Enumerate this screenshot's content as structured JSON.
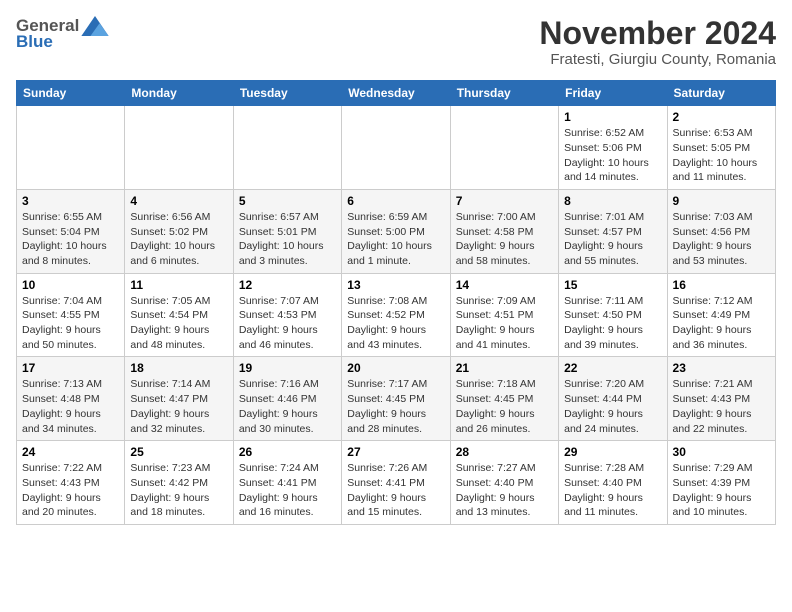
{
  "logo": {
    "general": "General",
    "blue": "Blue"
  },
  "title": "November 2024",
  "location": "Fratesti, Giurgiu County, Romania",
  "days_header": [
    "Sunday",
    "Monday",
    "Tuesday",
    "Wednesday",
    "Thursday",
    "Friday",
    "Saturday"
  ],
  "weeks": [
    [
      {
        "day": "",
        "info": ""
      },
      {
        "day": "",
        "info": ""
      },
      {
        "day": "",
        "info": ""
      },
      {
        "day": "",
        "info": ""
      },
      {
        "day": "",
        "info": ""
      },
      {
        "day": "1",
        "info": "Sunrise: 6:52 AM\nSunset: 5:06 PM\nDaylight: 10 hours and 14 minutes."
      },
      {
        "day": "2",
        "info": "Sunrise: 6:53 AM\nSunset: 5:05 PM\nDaylight: 10 hours and 11 minutes."
      }
    ],
    [
      {
        "day": "3",
        "info": "Sunrise: 6:55 AM\nSunset: 5:04 PM\nDaylight: 10 hours and 8 minutes."
      },
      {
        "day": "4",
        "info": "Sunrise: 6:56 AM\nSunset: 5:02 PM\nDaylight: 10 hours and 6 minutes."
      },
      {
        "day": "5",
        "info": "Sunrise: 6:57 AM\nSunset: 5:01 PM\nDaylight: 10 hours and 3 minutes."
      },
      {
        "day": "6",
        "info": "Sunrise: 6:59 AM\nSunset: 5:00 PM\nDaylight: 10 hours and 1 minute."
      },
      {
        "day": "7",
        "info": "Sunrise: 7:00 AM\nSunset: 4:58 PM\nDaylight: 9 hours and 58 minutes."
      },
      {
        "day": "8",
        "info": "Sunrise: 7:01 AM\nSunset: 4:57 PM\nDaylight: 9 hours and 55 minutes."
      },
      {
        "day": "9",
        "info": "Sunrise: 7:03 AM\nSunset: 4:56 PM\nDaylight: 9 hours and 53 minutes."
      }
    ],
    [
      {
        "day": "10",
        "info": "Sunrise: 7:04 AM\nSunset: 4:55 PM\nDaylight: 9 hours and 50 minutes."
      },
      {
        "day": "11",
        "info": "Sunrise: 7:05 AM\nSunset: 4:54 PM\nDaylight: 9 hours and 48 minutes."
      },
      {
        "day": "12",
        "info": "Sunrise: 7:07 AM\nSunset: 4:53 PM\nDaylight: 9 hours and 46 minutes."
      },
      {
        "day": "13",
        "info": "Sunrise: 7:08 AM\nSunset: 4:52 PM\nDaylight: 9 hours and 43 minutes."
      },
      {
        "day": "14",
        "info": "Sunrise: 7:09 AM\nSunset: 4:51 PM\nDaylight: 9 hours and 41 minutes."
      },
      {
        "day": "15",
        "info": "Sunrise: 7:11 AM\nSunset: 4:50 PM\nDaylight: 9 hours and 39 minutes."
      },
      {
        "day": "16",
        "info": "Sunrise: 7:12 AM\nSunset: 4:49 PM\nDaylight: 9 hours and 36 minutes."
      }
    ],
    [
      {
        "day": "17",
        "info": "Sunrise: 7:13 AM\nSunset: 4:48 PM\nDaylight: 9 hours and 34 minutes."
      },
      {
        "day": "18",
        "info": "Sunrise: 7:14 AM\nSunset: 4:47 PM\nDaylight: 9 hours and 32 minutes."
      },
      {
        "day": "19",
        "info": "Sunrise: 7:16 AM\nSunset: 4:46 PM\nDaylight: 9 hours and 30 minutes."
      },
      {
        "day": "20",
        "info": "Sunrise: 7:17 AM\nSunset: 4:45 PM\nDaylight: 9 hours and 28 minutes."
      },
      {
        "day": "21",
        "info": "Sunrise: 7:18 AM\nSunset: 4:45 PM\nDaylight: 9 hours and 26 minutes."
      },
      {
        "day": "22",
        "info": "Sunrise: 7:20 AM\nSunset: 4:44 PM\nDaylight: 9 hours and 24 minutes."
      },
      {
        "day": "23",
        "info": "Sunrise: 7:21 AM\nSunset: 4:43 PM\nDaylight: 9 hours and 22 minutes."
      }
    ],
    [
      {
        "day": "24",
        "info": "Sunrise: 7:22 AM\nSunset: 4:43 PM\nDaylight: 9 hours and 20 minutes."
      },
      {
        "day": "25",
        "info": "Sunrise: 7:23 AM\nSunset: 4:42 PM\nDaylight: 9 hours and 18 minutes."
      },
      {
        "day": "26",
        "info": "Sunrise: 7:24 AM\nSunset: 4:41 PM\nDaylight: 9 hours and 16 minutes."
      },
      {
        "day": "27",
        "info": "Sunrise: 7:26 AM\nSunset: 4:41 PM\nDaylight: 9 hours and 15 minutes."
      },
      {
        "day": "28",
        "info": "Sunrise: 7:27 AM\nSunset: 4:40 PM\nDaylight: 9 hours and 13 minutes."
      },
      {
        "day": "29",
        "info": "Sunrise: 7:28 AM\nSunset: 4:40 PM\nDaylight: 9 hours and 11 minutes."
      },
      {
        "day": "30",
        "info": "Sunrise: 7:29 AM\nSunset: 4:39 PM\nDaylight: 9 hours and 10 minutes."
      }
    ]
  ]
}
